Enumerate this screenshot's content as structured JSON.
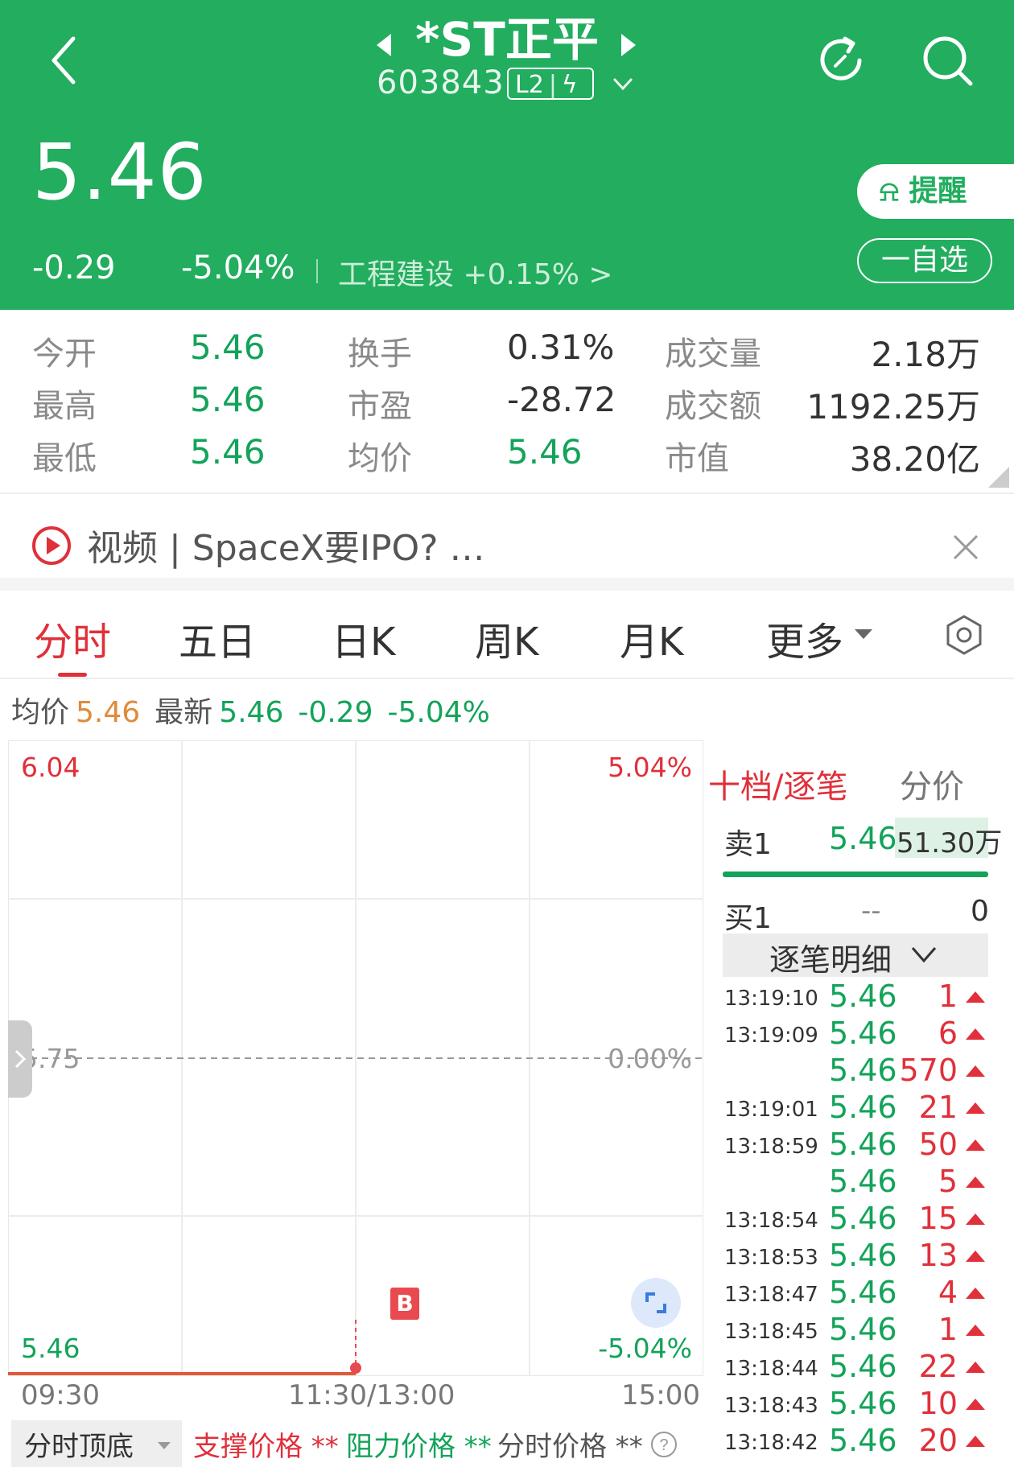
{
  "header": {
    "title": "*ST正平",
    "code": "603843",
    "badge_l2": "L2",
    "price": "5.46",
    "change": "-0.29",
    "change_pct": "-5.04%",
    "industry": "工程建设 +0.15% >",
    "remind_label": "提醒",
    "watchlist_label": "一自选"
  },
  "stats": {
    "open_label": "今开",
    "open_value": "5.46",
    "high_label": "最高",
    "high_value": "5.46",
    "low_label": "最低",
    "low_value": "5.46",
    "turnover_label": "换手",
    "turnover_value": "0.31%",
    "pe_label": "市盈",
    "pe_value": "-28.72",
    "avg_label": "均价",
    "avg_value": "5.46",
    "volume_label": "成交量",
    "volume_value": "2.18万",
    "amount_label": "成交额",
    "amount_value": "1192.25万",
    "mktcap_label": "市值",
    "mktcap_value": "38.20亿"
  },
  "video_banner": {
    "text": "视频 | SpaceX要IPO? …"
  },
  "tabs": [
    "分时",
    "五日",
    "日K",
    "周K",
    "月K",
    "更多"
  ],
  "chart_info": {
    "avg_label": "均价",
    "avg_value": "5.46",
    "latest_label": "最新",
    "latest_value": "5.46",
    "change": "-0.29",
    "change_pct": "-5.04%"
  },
  "chart": {
    "y_top": "6.04",
    "y_mid": "5.75",
    "y_bottom": "5.46",
    "pct_top": "5.04%",
    "pct_mid": "0.00%",
    "pct_bottom": "-5.04%",
    "marker": "B",
    "ticks": [
      "09:30",
      "11:30/13:00",
      "15:00"
    ]
  },
  "chart_data": {
    "type": "line",
    "x": [
      "09:30",
      "11:30/13:00"
    ],
    "series": [
      {
        "values": [
          5.46,
          5.46
        ]
      }
    ],
    "ylim": [
      5.46,
      6.04
    ],
    "xlabel": "",
    "ylabel": ""
  },
  "bottom_bar": {
    "dropdown": "分时顶底",
    "support": "支撑价格 **",
    "resistance": "阻力价格 **",
    "intraday": "分时价格 **"
  },
  "order_book": {
    "title": "十档/逐笔",
    "price_tab": "分价",
    "sell1_label": "卖1",
    "sell1_price": "5.46",
    "sell1_volume": "51.30万",
    "buy1_label": "买1",
    "buy1_price": "--",
    "buy1_volume": "0",
    "detail_label": "逐笔明细"
  },
  "trades": [
    {
      "time": "13:19:10",
      "price": "5.46",
      "vol": "1"
    },
    {
      "time": "13:19:09",
      "price": "5.46",
      "vol": "6"
    },
    {
      "time": "",
      "price": "5.46",
      "vol": "570"
    },
    {
      "time": "13:19:01",
      "price": "5.46",
      "vol": "21"
    },
    {
      "time": "13:18:59",
      "price": "5.46",
      "vol": "50"
    },
    {
      "time": "",
      "price": "5.46",
      "vol": "5"
    },
    {
      "time": "13:18:54",
      "price": "5.46",
      "vol": "15"
    },
    {
      "time": "13:18:53",
      "price": "5.46",
      "vol": "13"
    },
    {
      "time": "13:18:47",
      "price": "5.46",
      "vol": "4"
    },
    {
      "time": "13:18:45",
      "price": "5.46",
      "vol": "1"
    },
    {
      "time": "13:18:44",
      "price": "5.46",
      "vol": "22"
    },
    {
      "time": "13:18:43",
      "price": "5.46",
      "vol": "10"
    },
    {
      "time": "13:18:42",
      "price": "5.46",
      "vol": "20"
    }
  ]
}
